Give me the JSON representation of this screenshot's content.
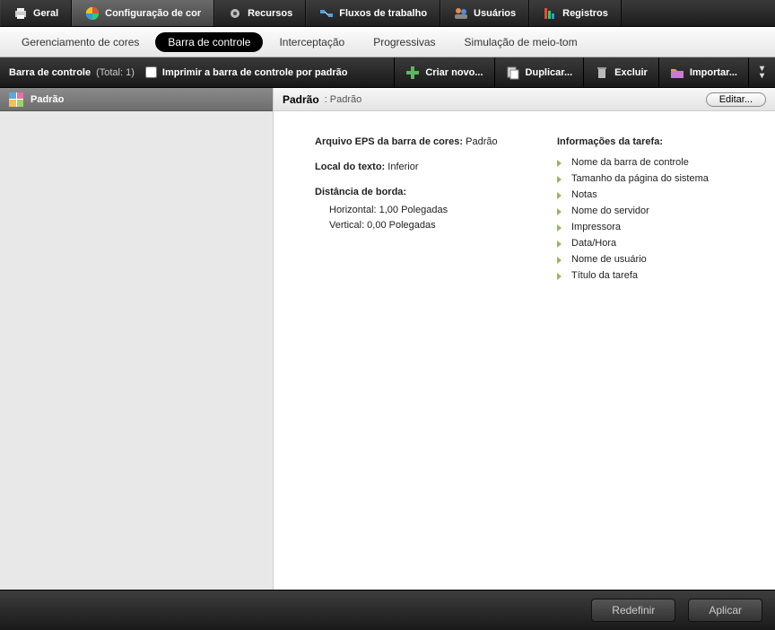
{
  "top_tabs": {
    "geral": "Geral",
    "config": "Configuração de cor",
    "recursos": "Recursos",
    "fluxos": "Fluxos de trabalho",
    "usuarios": "Usuários",
    "registros": "Registros"
  },
  "sub_nav": {
    "gerenciamento": "Gerenciamento de cores",
    "barra": "Barra de controle",
    "interceptacao": "Interceptação",
    "progressivas": "Progressivas",
    "meiotom": "Simulação de meio-tom"
  },
  "toolbar": {
    "title": "Barra de controle",
    "count": "(Total: 1)",
    "print_default_label": "Imprimir a barra de controle por padrão",
    "criar_novo": "Criar novo...",
    "duplicar": "Duplicar...",
    "excluir": "Excluir",
    "importar": "Importar..."
  },
  "sidebar": {
    "item": "Padrão"
  },
  "content": {
    "header_title": "Padrão",
    "header_sub": ": Padrão",
    "edit": "Editar...",
    "eps_label": "Arquivo EPS da barra de cores:",
    "eps_value": "Padrão",
    "local_label": "Local do texto:",
    "local_value": "Inferior",
    "borda_label": "Distância de borda:",
    "horizontal": "Horizontal: 1,00 Polegadas",
    "vertical": "Vertical: 0,00 Polegadas",
    "task_title": "Informações da tarefa:",
    "task_items": [
      "Nome da barra de controle",
      "Tamanho da página do sistema",
      "Notas",
      "Nome do servidor",
      "Impressora",
      "Data/Hora",
      "Nome de usuário",
      "Título da tarefa"
    ]
  },
  "footer": {
    "redefinir": "Redefinir",
    "aplicar": "Aplicar"
  }
}
